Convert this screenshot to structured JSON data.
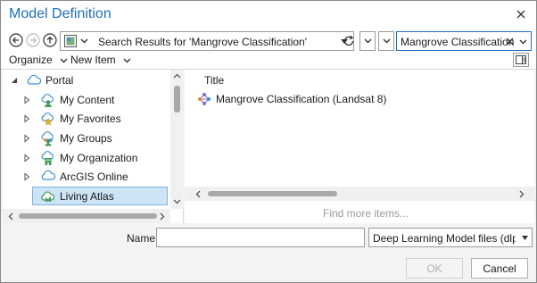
{
  "window": {
    "title": "Model Definition"
  },
  "nav": {
    "path": "Search Results for 'Mangrove Classification'",
    "search_value": "Mangrove Classification"
  },
  "toolbar": {
    "organize_label": "Organize",
    "new_item_label": "New Item"
  },
  "tree": {
    "items": [
      {
        "label": "Portal",
        "icon": "cloud-icon"
      },
      {
        "label": "My Content",
        "icon": "my-content-icon"
      },
      {
        "label": "My Favorites",
        "icon": "favorites-icon"
      },
      {
        "label": "My Groups",
        "icon": "groups-icon"
      },
      {
        "label": "My Organization",
        "icon": "organization-icon"
      },
      {
        "label": "ArcGIS Online",
        "icon": "cloud-icon"
      },
      {
        "label": "Living Atlas",
        "icon": "living-atlas-icon"
      }
    ]
  },
  "results": {
    "column_title": "Title",
    "items": [
      {
        "label": "Mangrove Classification (Landsat 8)",
        "icon": "deep-learning-model-icon"
      }
    ],
    "find_more": "Find more items..."
  },
  "footer": {
    "name_label": "Name",
    "name_value": "",
    "file_type": "Deep Learning Model files (dlpk, e",
    "ok_label": "OK",
    "cancel_label": "Cancel"
  },
  "colors": {
    "accent": "#1e6fba",
    "selection": "#cde3f6"
  }
}
